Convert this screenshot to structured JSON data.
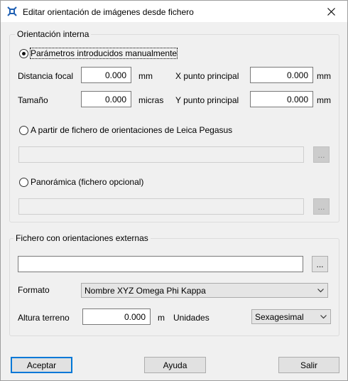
{
  "window": {
    "title": "Editar orientación de imágenes desde fichero"
  },
  "internal": {
    "group_label": "Orientación interna",
    "manual_radio": "Parámetros introducidos manualmente",
    "focal_label": "Distancia focal",
    "focal_value": "0.000",
    "focal_unit": "mm",
    "xpp_label": "X punto principal",
    "xpp_value": "0.000",
    "xpp_unit": "mm",
    "size_label": "Tamaño",
    "size_value": "0.000",
    "size_unit": "micras",
    "ypp_label": "Y punto principal",
    "ypp_value": "0.000",
    "ypp_unit": "mm",
    "leica_radio": "A partir de fichero de orientaciones de Leica Pegasus",
    "panoramic_radio": "Panorámica (fichero opcional)",
    "browse_label": "..."
  },
  "external": {
    "group_label": "Fichero con orientaciones externas",
    "file_value": "",
    "browse_label": "...",
    "format_label": "Formato",
    "format_value": "Nombre XYZ Omega Phi Kappa",
    "terrain_label": "Altura terreno",
    "terrain_value": "0.000",
    "terrain_unit": "m",
    "units_label": "Unidades",
    "units_value": "Sexagesimal"
  },
  "buttons": {
    "accept": "Aceptar",
    "help": "Ayuda",
    "exit": "Salir"
  },
  "colors": {
    "accent": "#0078d7",
    "background": "#f0f0f0"
  }
}
